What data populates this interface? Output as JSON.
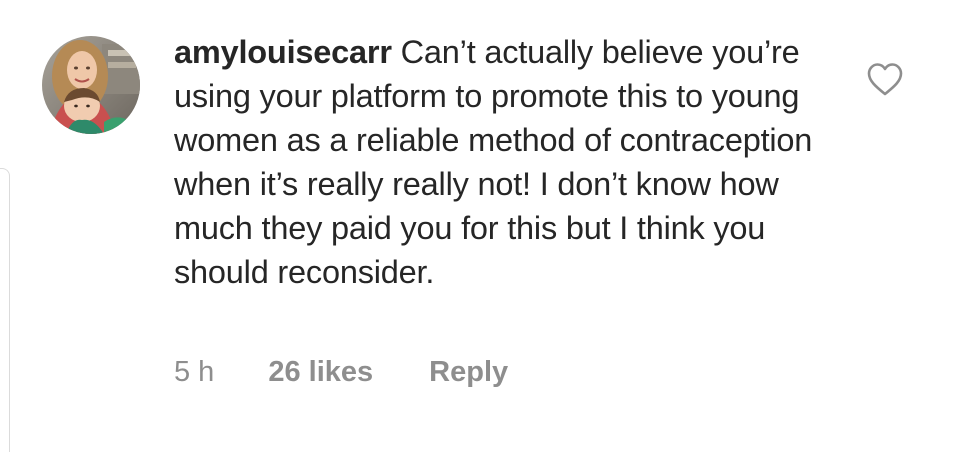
{
  "comment": {
    "username": "amylouisecarr",
    "text": "Can’t actually believe you’re using your platform to promote this to young women as a reliable method of contraception when it’s really really not! I don’t know how much they paid you for this but I think you should reconsider.",
    "time": "5 h",
    "likes": "26 likes",
    "reply_label": "Reply",
    "like_icon": "heart-outline-icon",
    "avatar": "user-profile-photo"
  }
}
